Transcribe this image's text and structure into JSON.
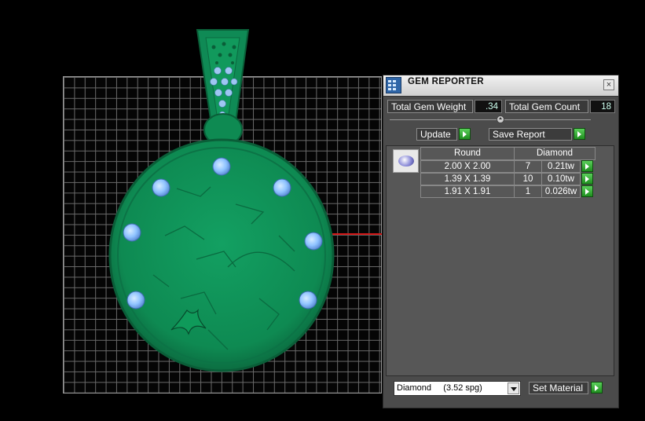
{
  "panel": {
    "title": "GEM REPORTER",
    "close_label": "×",
    "total_weight_label": "Total Gem Weight",
    "total_weight_value": ".34",
    "total_count_label": "Total Gem Count",
    "total_count_value": "18",
    "update_label": "Update",
    "save_report_label": "Save Report",
    "table": {
      "shape_header": "Round",
      "material_header": "Diamond",
      "rows": [
        {
          "size": "2.00 X 2.00",
          "count": "7",
          "tw": "0.21tw"
        },
        {
          "size": "1.39 X 1.39",
          "count": "10",
          "tw": "0.10tw"
        },
        {
          "size": "1.91 X 1.91",
          "count": "1",
          "tw": "0.026tw"
        }
      ]
    },
    "material_select_value": "Diamond     (3.52 spg)",
    "set_material_label": "Set Material"
  },
  "colors": {
    "model_green": "#0f8a55",
    "gem_blue": "#8fc3ff",
    "axis_red": "#d41818",
    "go_green": "#2fae2f"
  },
  "icons": [
    "gem-reporter-app-icon",
    "close-icon",
    "go-arrow-icon",
    "gem-thumbnail-icon",
    "dropdown-arrow-icon"
  ]
}
